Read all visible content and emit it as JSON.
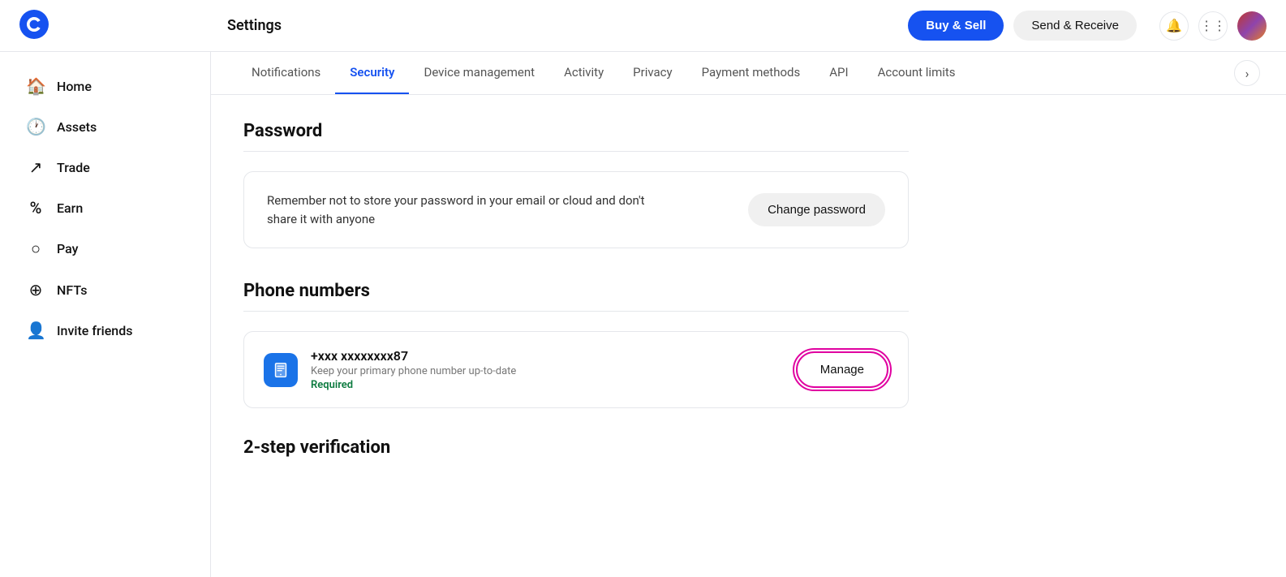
{
  "header": {
    "title": "Settings",
    "btn_buy_sell": "Buy & Sell",
    "btn_send_receive": "Send & Receive"
  },
  "sidebar": {
    "items": [
      {
        "id": "home",
        "label": "Home",
        "icon": "⌂"
      },
      {
        "id": "assets",
        "label": "Assets",
        "icon": "🕐"
      },
      {
        "id": "trade",
        "label": "Trade",
        "icon": "↗"
      },
      {
        "id": "earn",
        "label": "Earn",
        "icon": "%"
      },
      {
        "id": "pay",
        "label": "Pay",
        "icon": "○"
      },
      {
        "id": "nfts",
        "label": "NFTs",
        "icon": "⊕"
      },
      {
        "id": "invite",
        "label": "Invite friends",
        "icon": "👤"
      }
    ]
  },
  "tabs": [
    {
      "id": "notifications",
      "label": "Notifications",
      "active": false
    },
    {
      "id": "security",
      "label": "Security",
      "active": true
    },
    {
      "id": "device-management",
      "label": "Device management",
      "active": false
    },
    {
      "id": "activity",
      "label": "Activity",
      "active": false
    },
    {
      "id": "privacy",
      "label": "Privacy",
      "active": false
    },
    {
      "id": "payment-methods",
      "label": "Payment methods",
      "active": false
    },
    {
      "id": "api",
      "label": "API",
      "active": false
    },
    {
      "id": "account-limits",
      "label": "Account limits",
      "active": false
    }
  ],
  "password_section": {
    "title": "Password",
    "card_text": "Remember not to store your password in your email or cloud and don't share it with anyone",
    "btn_label": "Change password"
  },
  "phone_section": {
    "title": "Phone numbers",
    "phone_number": "+xxx xxxxxxxx87",
    "phone_subtitle": "Keep your primary phone number up-to-date",
    "required_label": "Required",
    "btn_label": "Manage"
  },
  "two_step_section": {
    "title": "2-step verification"
  }
}
